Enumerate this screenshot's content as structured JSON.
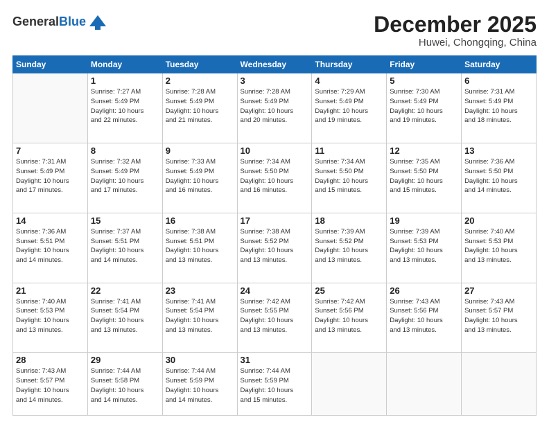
{
  "logo": {
    "general": "General",
    "blue": "Blue"
  },
  "header": {
    "month": "December 2025",
    "location": "Huwei, Chongqing, China"
  },
  "days_of_week": [
    "Sunday",
    "Monday",
    "Tuesday",
    "Wednesday",
    "Thursday",
    "Friday",
    "Saturday"
  ],
  "weeks": [
    [
      {
        "day": "",
        "info": ""
      },
      {
        "day": "1",
        "info": "Sunrise: 7:27 AM\nSunset: 5:49 PM\nDaylight: 10 hours\nand 22 minutes."
      },
      {
        "day": "2",
        "info": "Sunrise: 7:28 AM\nSunset: 5:49 PM\nDaylight: 10 hours\nand 21 minutes."
      },
      {
        "day": "3",
        "info": "Sunrise: 7:28 AM\nSunset: 5:49 PM\nDaylight: 10 hours\nand 20 minutes."
      },
      {
        "day": "4",
        "info": "Sunrise: 7:29 AM\nSunset: 5:49 PM\nDaylight: 10 hours\nand 19 minutes."
      },
      {
        "day": "5",
        "info": "Sunrise: 7:30 AM\nSunset: 5:49 PM\nDaylight: 10 hours\nand 19 minutes."
      },
      {
        "day": "6",
        "info": "Sunrise: 7:31 AM\nSunset: 5:49 PM\nDaylight: 10 hours\nand 18 minutes."
      }
    ],
    [
      {
        "day": "7",
        "info": "Sunrise: 7:31 AM\nSunset: 5:49 PM\nDaylight: 10 hours\nand 17 minutes."
      },
      {
        "day": "8",
        "info": "Sunrise: 7:32 AM\nSunset: 5:49 PM\nDaylight: 10 hours\nand 17 minutes."
      },
      {
        "day": "9",
        "info": "Sunrise: 7:33 AM\nSunset: 5:49 PM\nDaylight: 10 hours\nand 16 minutes."
      },
      {
        "day": "10",
        "info": "Sunrise: 7:34 AM\nSunset: 5:50 PM\nDaylight: 10 hours\nand 16 minutes."
      },
      {
        "day": "11",
        "info": "Sunrise: 7:34 AM\nSunset: 5:50 PM\nDaylight: 10 hours\nand 15 minutes."
      },
      {
        "day": "12",
        "info": "Sunrise: 7:35 AM\nSunset: 5:50 PM\nDaylight: 10 hours\nand 15 minutes."
      },
      {
        "day": "13",
        "info": "Sunrise: 7:36 AM\nSunset: 5:50 PM\nDaylight: 10 hours\nand 14 minutes."
      }
    ],
    [
      {
        "day": "14",
        "info": "Sunrise: 7:36 AM\nSunset: 5:51 PM\nDaylight: 10 hours\nand 14 minutes."
      },
      {
        "day": "15",
        "info": "Sunrise: 7:37 AM\nSunset: 5:51 PM\nDaylight: 10 hours\nand 14 minutes."
      },
      {
        "day": "16",
        "info": "Sunrise: 7:38 AM\nSunset: 5:51 PM\nDaylight: 10 hours\nand 13 minutes."
      },
      {
        "day": "17",
        "info": "Sunrise: 7:38 AM\nSunset: 5:52 PM\nDaylight: 10 hours\nand 13 minutes."
      },
      {
        "day": "18",
        "info": "Sunrise: 7:39 AM\nSunset: 5:52 PM\nDaylight: 10 hours\nand 13 minutes."
      },
      {
        "day": "19",
        "info": "Sunrise: 7:39 AM\nSunset: 5:53 PM\nDaylight: 10 hours\nand 13 minutes."
      },
      {
        "day": "20",
        "info": "Sunrise: 7:40 AM\nSunset: 5:53 PM\nDaylight: 10 hours\nand 13 minutes."
      }
    ],
    [
      {
        "day": "21",
        "info": "Sunrise: 7:40 AM\nSunset: 5:53 PM\nDaylight: 10 hours\nand 13 minutes."
      },
      {
        "day": "22",
        "info": "Sunrise: 7:41 AM\nSunset: 5:54 PM\nDaylight: 10 hours\nand 13 minutes."
      },
      {
        "day": "23",
        "info": "Sunrise: 7:41 AM\nSunset: 5:54 PM\nDaylight: 10 hours\nand 13 minutes."
      },
      {
        "day": "24",
        "info": "Sunrise: 7:42 AM\nSunset: 5:55 PM\nDaylight: 10 hours\nand 13 minutes."
      },
      {
        "day": "25",
        "info": "Sunrise: 7:42 AM\nSunset: 5:56 PM\nDaylight: 10 hours\nand 13 minutes."
      },
      {
        "day": "26",
        "info": "Sunrise: 7:43 AM\nSunset: 5:56 PM\nDaylight: 10 hours\nand 13 minutes."
      },
      {
        "day": "27",
        "info": "Sunrise: 7:43 AM\nSunset: 5:57 PM\nDaylight: 10 hours\nand 13 minutes."
      }
    ],
    [
      {
        "day": "28",
        "info": "Sunrise: 7:43 AM\nSunset: 5:57 PM\nDaylight: 10 hours\nand 14 minutes."
      },
      {
        "day": "29",
        "info": "Sunrise: 7:44 AM\nSunset: 5:58 PM\nDaylight: 10 hours\nand 14 minutes."
      },
      {
        "day": "30",
        "info": "Sunrise: 7:44 AM\nSunset: 5:59 PM\nDaylight: 10 hours\nand 14 minutes."
      },
      {
        "day": "31",
        "info": "Sunrise: 7:44 AM\nSunset: 5:59 PM\nDaylight: 10 hours\nand 15 minutes."
      },
      {
        "day": "",
        "info": ""
      },
      {
        "day": "",
        "info": ""
      },
      {
        "day": "",
        "info": ""
      }
    ]
  ]
}
